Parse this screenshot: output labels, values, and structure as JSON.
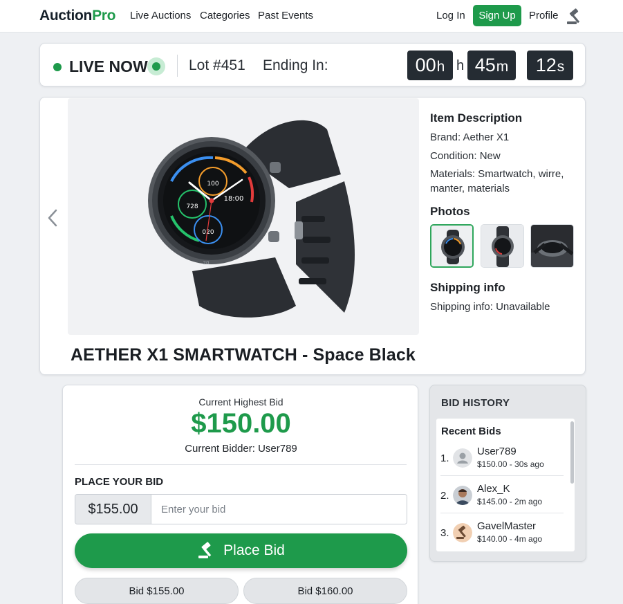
{
  "nav": {
    "logo_part1": "Auction",
    "logo_part2": "Pro",
    "links": [
      "Live Auctions",
      "Categories",
      "Past Events"
    ],
    "login": "Log In",
    "signup": "Sign Up",
    "profile": "Profile"
  },
  "live": {
    "status": "LIVE NOW",
    "lot": "Lot #451",
    "ending_label": "Ending In:",
    "hours": "00",
    "hours_unit": "h",
    "hours_sep": "h",
    "minutes": "45",
    "minutes_unit": "m",
    "seconds": "12",
    "seconds_unit": "s"
  },
  "product": {
    "title": "AETHER X1 SMARTWATCH - Space Black",
    "description_heading": "Item Description",
    "brand": "Brand: Aether X1",
    "condition": "Condition: New",
    "materials": "Materials: Smartwatch, wirre, manter, materials",
    "photos_heading": "Photos",
    "shipping_heading": "Shipping info",
    "shipping": "Shipping info: Unavailable",
    "watch_face": {
      "top": "100",
      "left": "728",
      "time": "18:00",
      "bottom": "020",
      "bezel": "20"
    }
  },
  "bid": {
    "current_label": "Current Highest Bid",
    "current_amount": "$150.00",
    "current_bidder": "Current Bidder: User789",
    "place_heading": "PLACE YOUR BID",
    "prefix_value": "$155.00",
    "input_placeholder": "Enter your bid",
    "place_button": "Place Bid",
    "quick": [
      "Bid $155.00",
      "Bid $160.00"
    ]
  },
  "history": {
    "title": "BID HISTORY",
    "subtitle": "Recent Bids",
    "rows": [
      {
        "index": "1.",
        "name": "User789",
        "meta": "$150.00 - 30s ago"
      },
      {
        "index": "2.",
        "name": "Alex_K",
        "meta": "$145.00 - 2m ago"
      },
      {
        "index": "3.",
        "name": "GavelMaster",
        "meta": "$140.00 - 4m ago"
      }
    ]
  },
  "colors": {
    "accent": "#1e9a4b",
    "timer_bg": "#252c33",
    "background": "#eef0f3"
  },
  "icons": [
    "gavel-icon",
    "chevron-left-icon",
    "live-dot-icon",
    "avatar-placeholder-icon"
  ]
}
